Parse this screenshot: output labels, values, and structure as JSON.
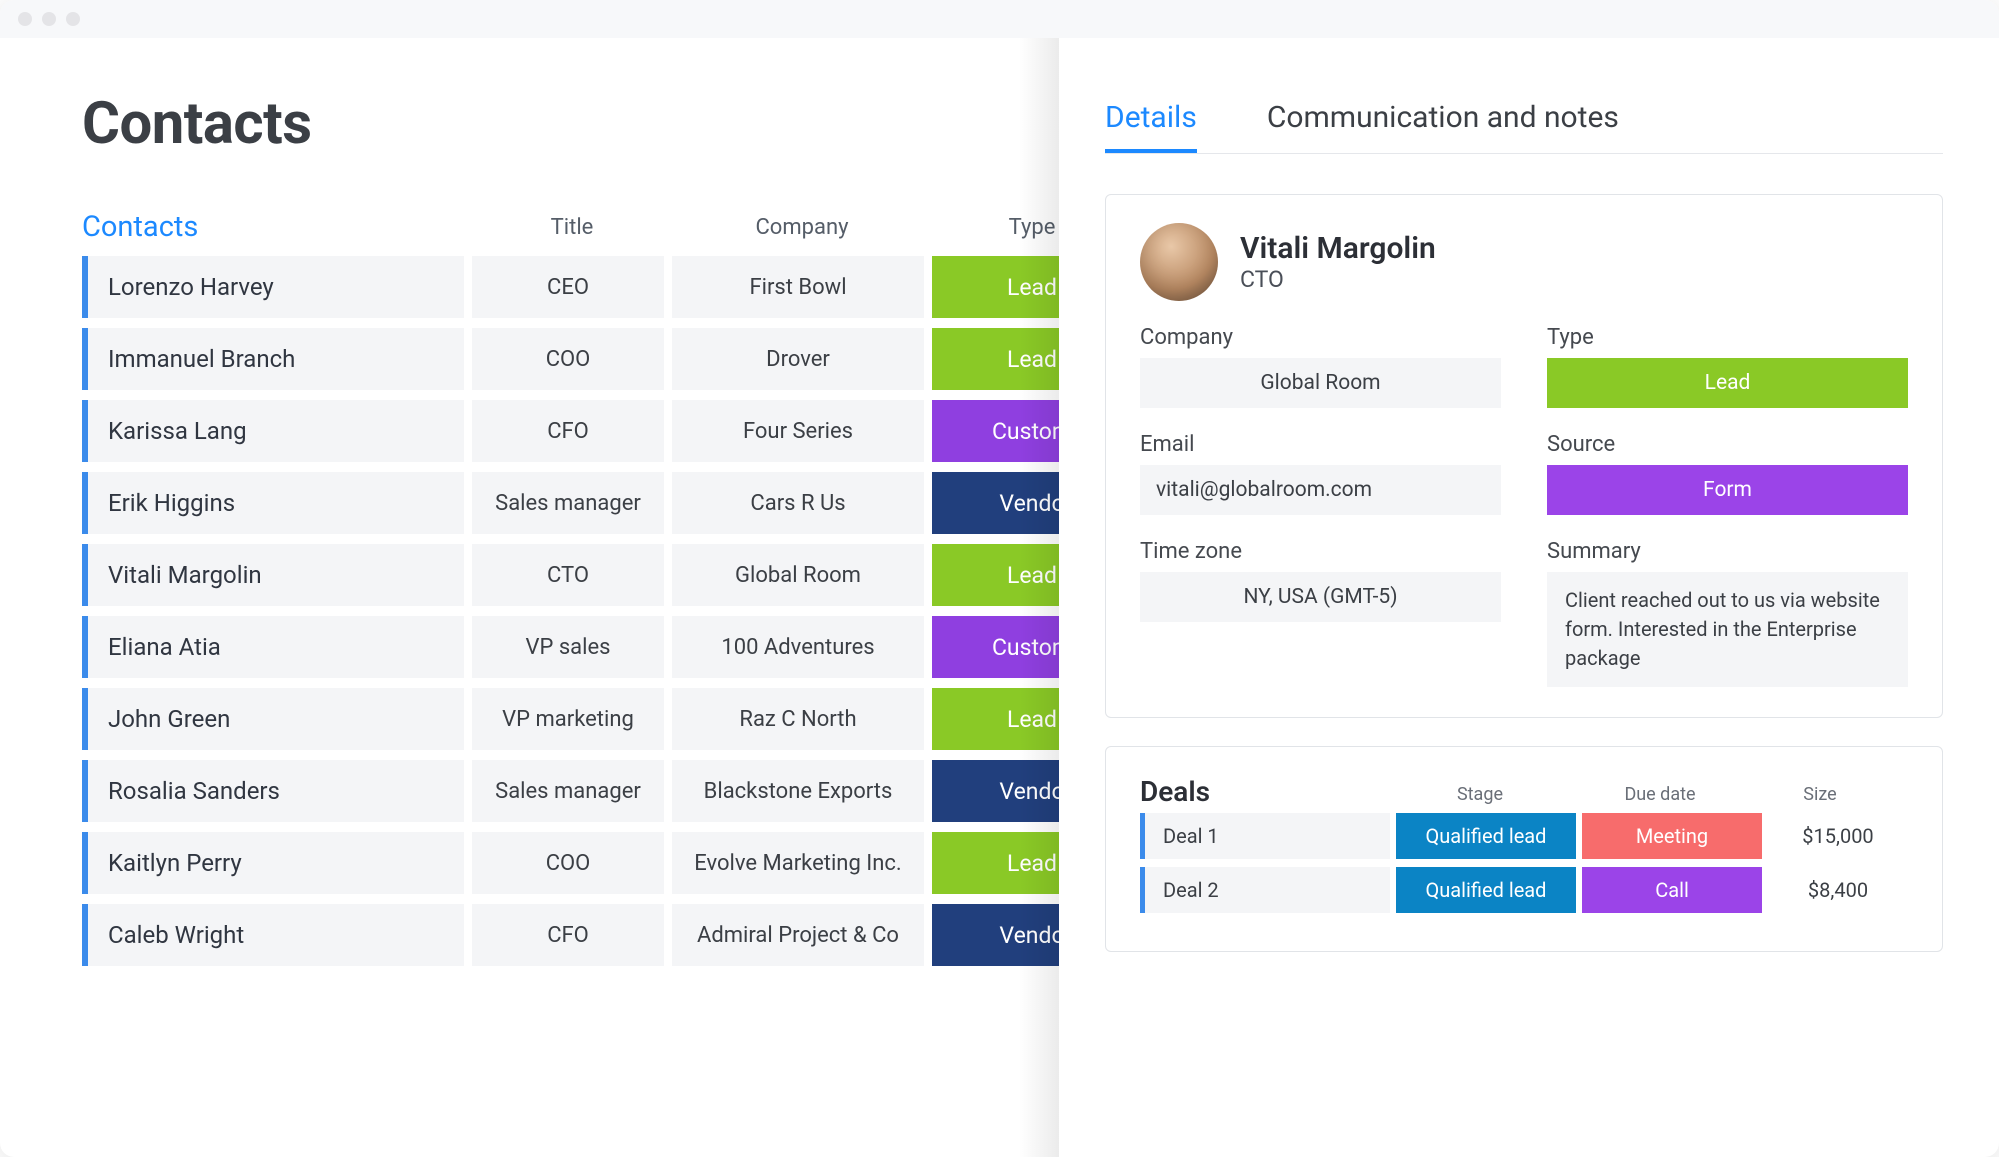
{
  "page_title": "Contacts",
  "table": {
    "contacts_label": "Contacts",
    "columns": {
      "title": "Title",
      "company": "Company",
      "type": "Type"
    },
    "rows": [
      {
        "name": "Lorenzo Harvey",
        "title": "CEO",
        "company": "First Bowl",
        "type": "Lead"
      },
      {
        "name": "Immanuel Branch",
        "title": "COO",
        "company": "Drover",
        "type": "Lead"
      },
      {
        "name": "Karissa Lang",
        "title": "CFO",
        "company": "Four Series",
        "type": "Customer"
      },
      {
        "name": "Erik Higgins",
        "title": "Sales manager",
        "company": "Cars R Us",
        "type": "Vendor"
      },
      {
        "name": "Vitali Margolin",
        "title": "CTO",
        "company": "Global Room",
        "type": "Lead"
      },
      {
        "name": "Eliana Atia",
        "title": "VP sales",
        "company": "100 Adventures",
        "type": "Customer"
      },
      {
        "name": "John Green",
        "title": "VP marketing",
        "company": "Raz C North",
        "type": "Lead"
      },
      {
        "name": "Rosalia Sanders",
        "title": "Sales manager",
        "company": "Blackstone Exports",
        "type": "Vendor"
      },
      {
        "name": "Kaitlyn Perry",
        "title": "COO",
        "company": "Evolve Marketing Inc.",
        "type": "Lead"
      },
      {
        "name": "Caleb Wright",
        "title": "CFO",
        "company": "Admiral Project & Co",
        "type": "Vendor"
      }
    ],
    "type_display": {
      "Lead": "Lead",
      "Customer": "Custom",
      "Vendor": "Vendo"
    }
  },
  "tabs": {
    "details": "Details",
    "comm": "Communication and notes",
    "active": "details"
  },
  "detail": {
    "name": "Vitali Margolin",
    "title": "CTO",
    "labels": {
      "company": "Company",
      "type": "Type",
      "email": "Email",
      "source": "Source",
      "timezone": "Time zone",
      "summary": "Summary"
    },
    "company": "Global Room",
    "type": "Lead",
    "email": "vitali@globalroom.com",
    "source": "Form",
    "timezone": "NY, USA (GMT-5)",
    "summary": "Client reached out to us via website form. Interested in the Enterprise package"
  },
  "deals": {
    "title": "Deals",
    "columns": {
      "stage": "Stage",
      "due": "Due date",
      "size": "Size"
    },
    "rows": [
      {
        "name": "Deal 1",
        "stage": "Qualified lead",
        "due": "Meeting",
        "size": "$15,000"
      },
      {
        "name": "Deal 2",
        "stage": "Qualified lead",
        "due": "Call",
        "size": "$8,400"
      }
    ]
  }
}
